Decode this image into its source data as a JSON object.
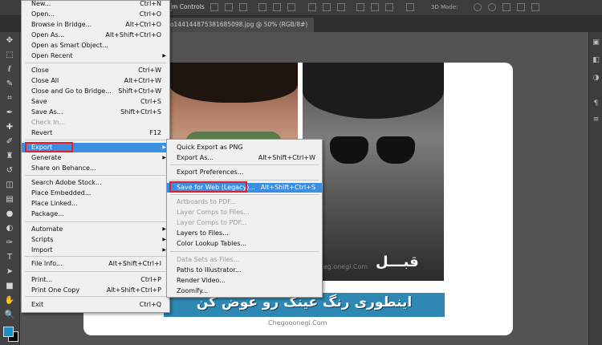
{
  "options_bar": {
    "show_transform_controls": "m Controls",
    "mode_3d": "3D Mode:"
  },
  "doc_tab": {
    "title": "to1441448753816850​98.jpg @ 50% (RGB/8#)"
  },
  "file_menu": {
    "items": [
      {
        "label": "New...",
        "shortcut": "Ctrl+N"
      },
      {
        "label": "Open...",
        "shortcut": "Ctrl+O"
      },
      {
        "label": "Browse in Bridge...",
        "shortcut": "Alt+Ctrl+O"
      },
      {
        "label": "Open As...",
        "shortcut": "Alt+Shift+Ctrl+O"
      },
      {
        "label": "Open as Smart Object...",
        "shortcut": ""
      },
      {
        "label": "Open Recent",
        "shortcut": "",
        "submenu": true
      },
      {
        "label": "Close",
        "shortcut": "Ctrl+W"
      },
      {
        "label": "Close All",
        "shortcut": "Alt+Ctrl+W"
      },
      {
        "label": "Close and Go to Bridge...",
        "shortcut": "Shift+Ctrl+W"
      },
      {
        "label": "Save",
        "shortcut": "Ctrl+S"
      },
      {
        "label": "Save As...",
        "shortcut": "Shift+Ctrl+S"
      },
      {
        "label": "Check In...",
        "shortcut": "",
        "disabled": true
      },
      {
        "label": "Revert",
        "shortcut": "F12"
      },
      {
        "label": "Export",
        "shortcut": "",
        "submenu": true,
        "highlighted": true
      },
      {
        "label": "Generate",
        "shortcut": "",
        "submenu": true
      },
      {
        "label": "Share on Behance...",
        "shortcut": ""
      },
      {
        "label": "Search Adobe Stock...",
        "shortcut": ""
      },
      {
        "label": "Place Embedded...",
        "shortcut": ""
      },
      {
        "label": "Place Linked...",
        "shortcut": ""
      },
      {
        "label": "Package...",
        "shortcut": ""
      },
      {
        "label": "Automate",
        "shortcut": "",
        "submenu": true
      },
      {
        "label": "Scripts",
        "shortcut": "",
        "submenu": true
      },
      {
        "label": "Import",
        "shortcut": "",
        "submenu": true
      },
      {
        "label": "File Info...",
        "shortcut": "Alt+Shift+Ctrl+I"
      },
      {
        "label": "Print...",
        "shortcut": "Ctrl+P"
      },
      {
        "label": "Print One Copy",
        "shortcut": "Alt+Shift+Ctrl+P"
      },
      {
        "label": "Exit",
        "shortcut": "Ctrl+Q"
      }
    ]
  },
  "export_menu": {
    "items": [
      {
        "label": "Quick Export as PNG",
        "shortcut": ""
      },
      {
        "label": "Export As...",
        "shortcut": "Alt+Shift+Ctrl+W"
      },
      {
        "label": "Export Preferences...",
        "shortcut": ""
      },
      {
        "label": "Save for Web (Legacy)...",
        "shortcut": "Alt+Shift+Ctrl+S",
        "highlighted": true
      },
      {
        "label": "Artboards to PDF...",
        "shortcut": "",
        "disabled": true
      },
      {
        "label": "Layer Comps to Files...",
        "shortcut": "",
        "disabled": true
      },
      {
        "label": "Layer Comps to PDF...",
        "shortcut": "",
        "disabled": true
      },
      {
        "label": "Layers to Files...",
        "shortcut": ""
      },
      {
        "label": "Color Lookup Tables...",
        "shortcut": ""
      },
      {
        "label": "Data Sets as Files...",
        "shortcut": "",
        "disabled": true
      },
      {
        "label": "Paths to Illustrator...",
        "shortcut": ""
      },
      {
        "label": "Render Video...",
        "shortcut": ""
      },
      {
        "label": "Zoomify...",
        "shortcut": ""
      }
    ]
  },
  "canvas": {
    "caption_before": "قبـــل",
    "banner_text": "اینطوری رنگ عینک رو عوض کن",
    "watermark_1": "Cheg.onegi.Com",
    "watermark_2": "Chegooonegi.Com"
  },
  "colors": {
    "highlight": "#3c8fe0",
    "red_box": "#e0202a",
    "foreground_swatch": "#1a8fc4"
  }
}
